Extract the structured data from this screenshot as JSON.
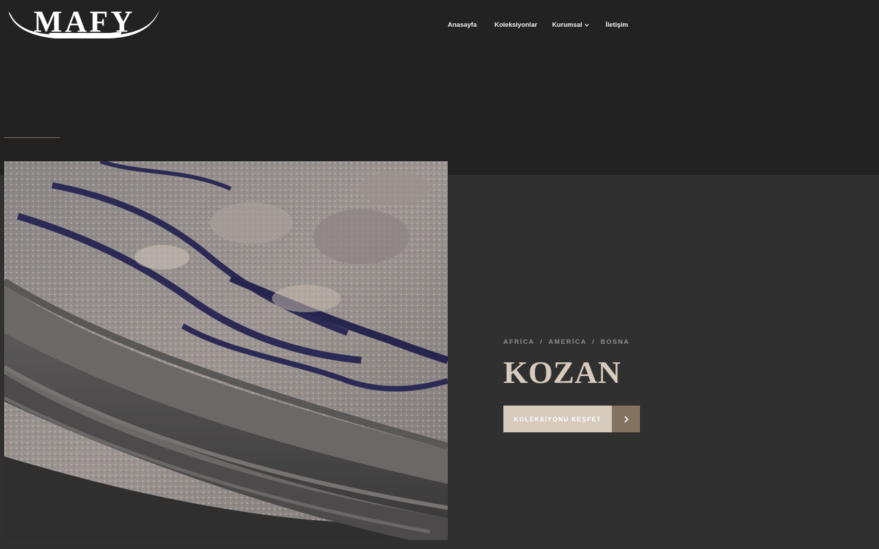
{
  "brand": {
    "logo_text": "MAFY"
  },
  "nav": {
    "items": [
      {
        "label": "Anasayfa"
      },
      {
        "label": "Koleksiyonlar"
      },
      {
        "label": "Kurumsal"
      },
      {
        "label": "İletişim"
      }
    ]
  },
  "hero": {
    "categories": [
      "AFRİCA",
      "AMERİCA",
      "BOSNA"
    ],
    "separator": "/",
    "title": "KOZAN",
    "cta_label": "KOLEKSİYONU KEŞFET",
    "image_alt": "rug-photo"
  },
  "colors": {
    "accent": "#d6cbbd",
    "accent_dark": "#847260",
    "band": "#222222",
    "background": "#303030"
  }
}
